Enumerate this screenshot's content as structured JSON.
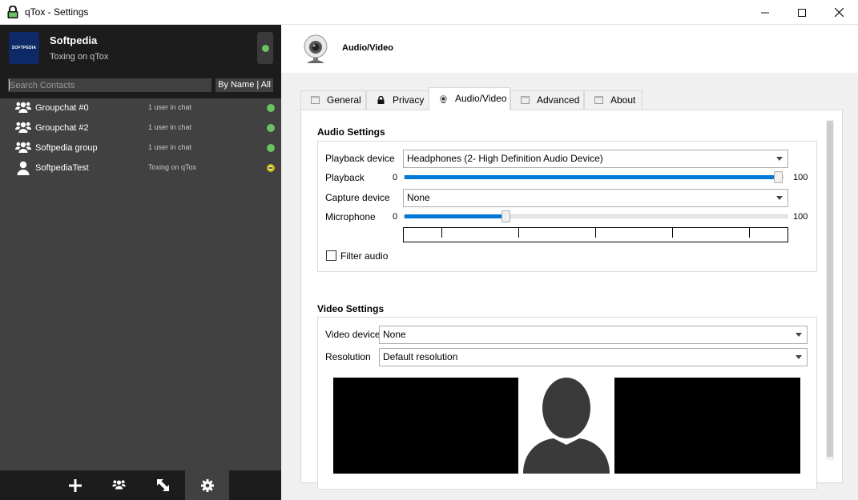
{
  "window": {
    "title": "qTox - Settings"
  },
  "profile": {
    "name": "Softpedia",
    "status_text": "Toxing on qTox",
    "avatar_text": "SOFTPEDIA"
  },
  "search": {
    "placeholder": "Search Contacts",
    "sort_label": "By Name | All"
  },
  "contacts": [
    {
      "name": "Groupchat #0",
      "status": "1 user in chat",
      "icon": "group-icon",
      "presence": "online"
    },
    {
      "name": "Groupchat #2",
      "status": "1 user in chat",
      "icon": "group-icon",
      "presence": "online"
    },
    {
      "name": "Softpedia group",
      "status": "1 user in chat",
      "icon": "group-icon",
      "presence": "online"
    },
    {
      "name": "SoftpediaTest",
      "status": "Toxing on qTox",
      "icon": "user-icon",
      "presence": "away"
    }
  ],
  "bottom_bar": [
    {
      "icon": "add-friend-icon"
    },
    {
      "icon": "group-chat-icon"
    },
    {
      "icon": "file-transfer-icon"
    },
    {
      "icon": "settings-gear-icon",
      "active": true
    }
  ],
  "header": {
    "title": "Audio/Video"
  },
  "tabs": [
    {
      "label": "General",
      "icon": "general-icon"
    },
    {
      "label": "Privacy",
      "icon": "lock-icon"
    },
    {
      "label": "Audio/Video",
      "icon": "webcam-icon",
      "active": true
    },
    {
      "label": "Advanced",
      "icon": "advanced-icon"
    },
    {
      "label": "About",
      "icon": "about-icon"
    }
  ],
  "audio": {
    "section_title": "Audio Settings",
    "playback_device_label": "Playback device",
    "playback_device_value": "Headphones (2- High Definition Audio Device)",
    "playback_label": "Playback",
    "playback_min": "0",
    "playback_max": "100",
    "playback_level": 100,
    "capture_device_label": "Capture device",
    "capture_device_value": "None",
    "microphone_label": "Microphone",
    "microphone_min": "0",
    "microphone_max": "100",
    "microphone_level": 26,
    "filter_audio_label": "Filter audio",
    "filter_audio_checked": false
  },
  "video": {
    "section_title": "Video Settings",
    "video_device_label": "Video device",
    "video_device_value": "None",
    "resolution_label": "Resolution",
    "resolution_value": "Default resolution"
  },
  "colors": {
    "accent": "#0078d7",
    "online": "#6bc260",
    "sidebar_dark": "#1c1c1c",
    "sidebar": "#414141"
  }
}
